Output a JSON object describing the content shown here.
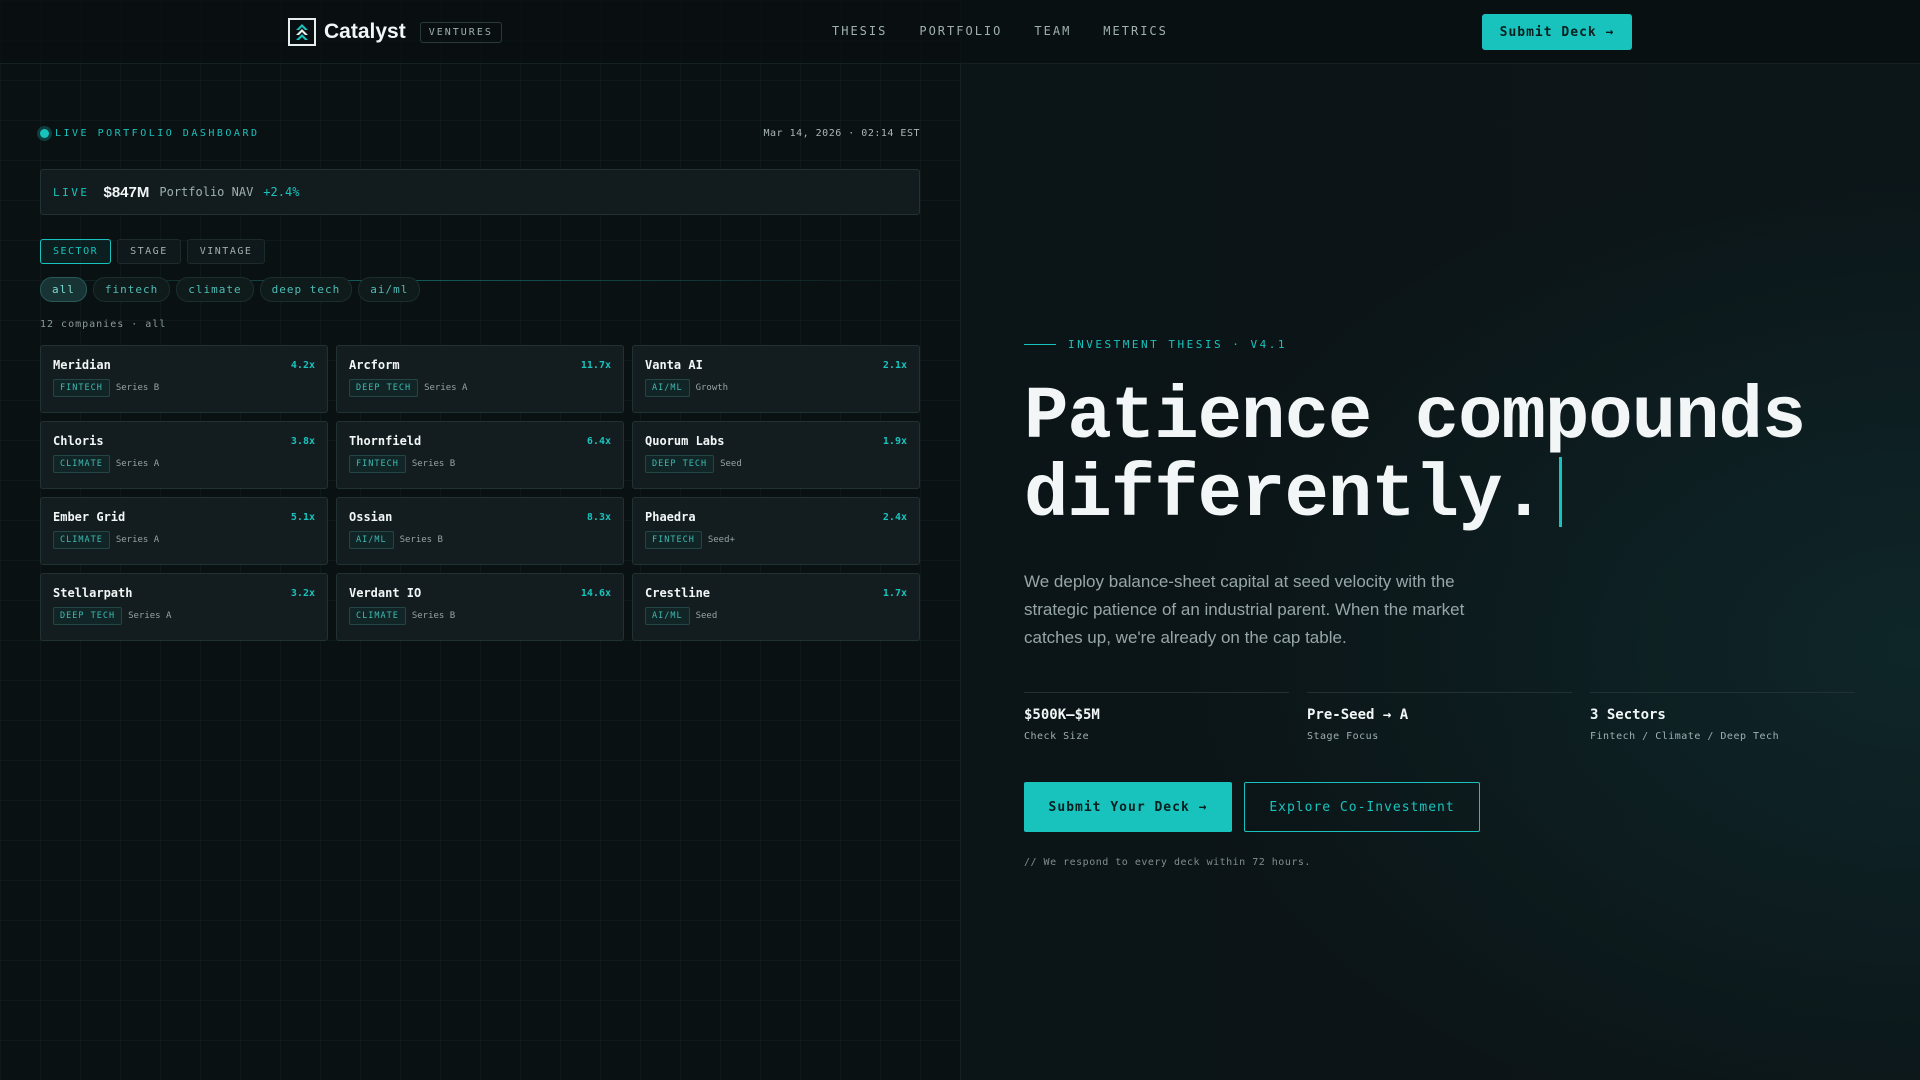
{
  "header": {
    "brand": "Catalyst",
    "badge": "VENTURES",
    "nav": [
      "THESIS",
      "PORTFOLIO",
      "TEAM",
      "METRICS"
    ],
    "cta": "Submit Deck →"
  },
  "dashboard": {
    "label": "LIVE PORTFOLIO DASHBOARD",
    "date": "Mar 14, 2026 · 02:14 EST",
    "nav_bar": {
      "live": "LIVE",
      "value": "$847M",
      "label": "Portfolio NAV",
      "change": "+2.4%"
    },
    "tabs": [
      "SECTOR",
      "STAGE",
      "VINTAGE"
    ],
    "active_tab": 0,
    "chips": [
      "all",
      "fintech",
      "climate",
      "deep tech",
      "ai/ml"
    ],
    "active_chip": 0,
    "count": "12 companies · all",
    "companies": [
      {
        "name": "Meridian",
        "multiple": "4.2x",
        "tag": "FINTECH",
        "stage": "Series B"
      },
      {
        "name": "Arcform",
        "multiple": "11.7x",
        "tag": "DEEP TECH",
        "stage": "Series A"
      },
      {
        "name": "Vanta AI",
        "multiple": "2.1x",
        "tag": "AI/ML",
        "stage": "Growth"
      },
      {
        "name": "Chloris",
        "multiple": "3.8x",
        "tag": "CLIMATE",
        "stage": "Series A"
      },
      {
        "name": "Thornfield",
        "multiple": "6.4x",
        "tag": "FINTECH",
        "stage": "Series B"
      },
      {
        "name": "Quorum Labs",
        "multiple": "1.9x",
        "tag": "DEEP TECH",
        "stage": "Seed"
      },
      {
        "name": "Ember Grid",
        "multiple": "5.1x",
        "tag": "CLIMATE",
        "stage": "Series A"
      },
      {
        "name": "Ossian",
        "multiple": "8.3x",
        "tag": "AI/ML",
        "stage": "Series B"
      },
      {
        "name": "Phaedra",
        "multiple": "2.4x",
        "tag": "FINTECH",
        "stage": "Seed+"
      },
      {
        "name": "Stellarpath",
        "multiple": "3.2x",
        "tag": "DEEP TECH",
        "stage": "Series A"
      },
      {
        "name": "Verdant IO",
        "multiple": "14.6x",
        "tag": "CLIMATE",
        "stage": "Series B"
      },
      {
        "name": "Crestline",
        "multiple": "1.7x",
        "tag": "AI/ML",
        "stage": "Seed"
      }
    ]
  },
  "hero": {
    "tag": "INVESTMENT THESIS · V4.1",
    "headline_1": "Patience compounds",
    "headline_2": "differently.",
    "description": "We deploy balance-sheet capital at seed velocity with the strategic patience of an industrial parent. When the market catches up, we're already on the cap table.",
    "stats": [
      {
        "value": "$500K–$5M",
        "label": "Check Size"
      },
      {
        "value": "Pre-Seed → A",
        "label": "Stage Focus"
      },
      {
        "value": "3 Sectors",
        "label": "Fintech / Climate / Deep Tech"
      }
    ],
    "primary_cta": "Submit Your Deck →",
    "secondary_cta": "Explore Co-Investment",
    "note": "// We respond to every deck within 72 hours."
  },
  "colors": {
    "accent": "#19c3bd",
    "background": "#0a1113",
    "card": "#131d20"
  },
  "icons": {
    "logo": "catalyst-logo-icon",
    "live": "live-dot-icon"
  }
}
